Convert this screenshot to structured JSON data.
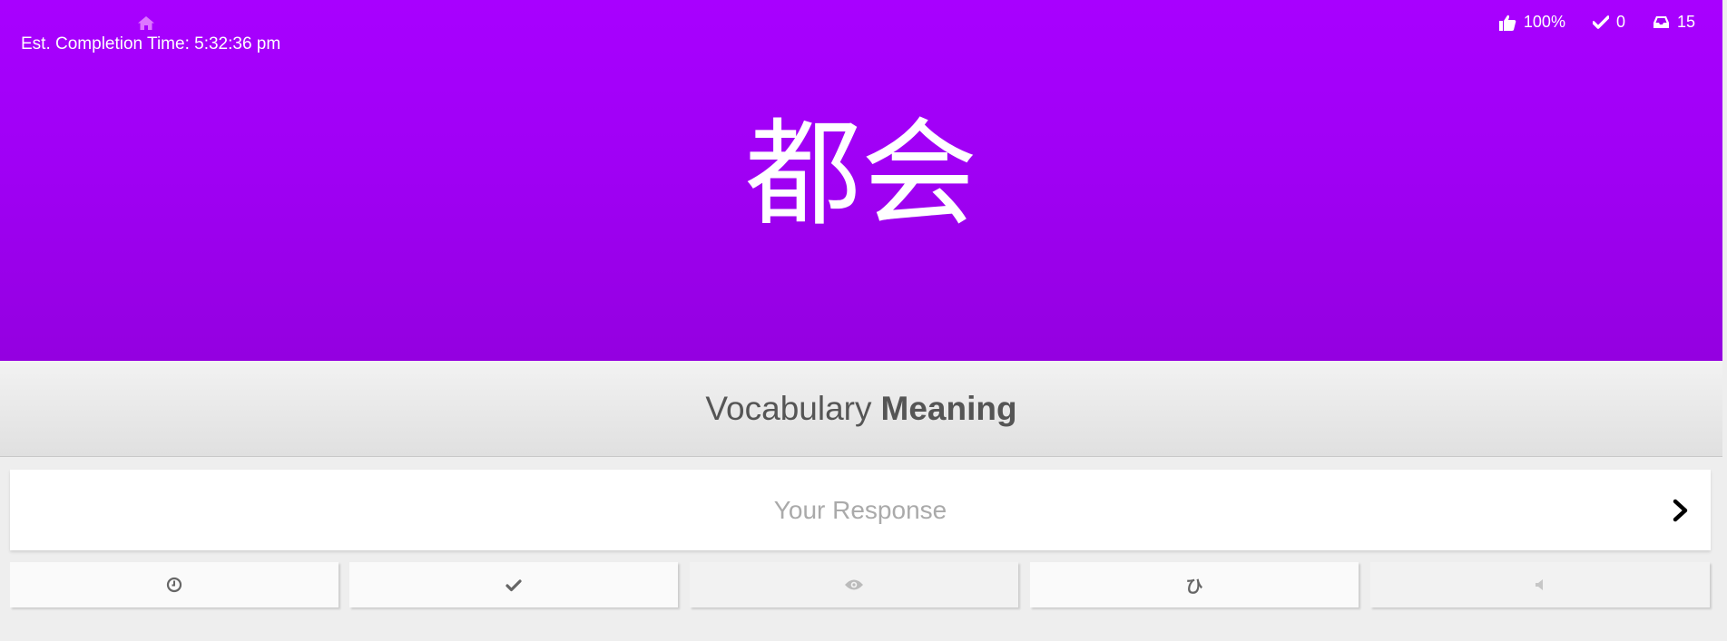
{
  "header": {
    "home_icon": "home-icon",
    "est_completion": "Est. Completion Time: 5:32:36 pm",
    "stats": {
      "accuracy": "100%",
      "completed": "0",
      "remaining": "15"
    }
  },
  "review": {
    "character": "都会",
    "item_type": "Vocabulary",
    "question_type": "Meaning"
  },
  "response": {
    "placeholder": "Your Response",
    "submit_icon": "chevron-right-icon"
  },
  "actions": [
    {
      "icon": "clock-icon",
      "enabled": true
    },
    {
      "icon": "check-icon",
      "enabled": true
    },
    {
      "icon": "eye-icon",
      "enabled": false
    },
    {
      "icon": "hiragana-icon",
      "glyph": "ひ",
      "enabled": true
    },
    {
      "icon": "audio-icon",
      "enabled": false
    }
  ],
  "colors": {
    "accent_vocabulary": "#a800ff",
    "background": "#eeeeee"
  }
}
